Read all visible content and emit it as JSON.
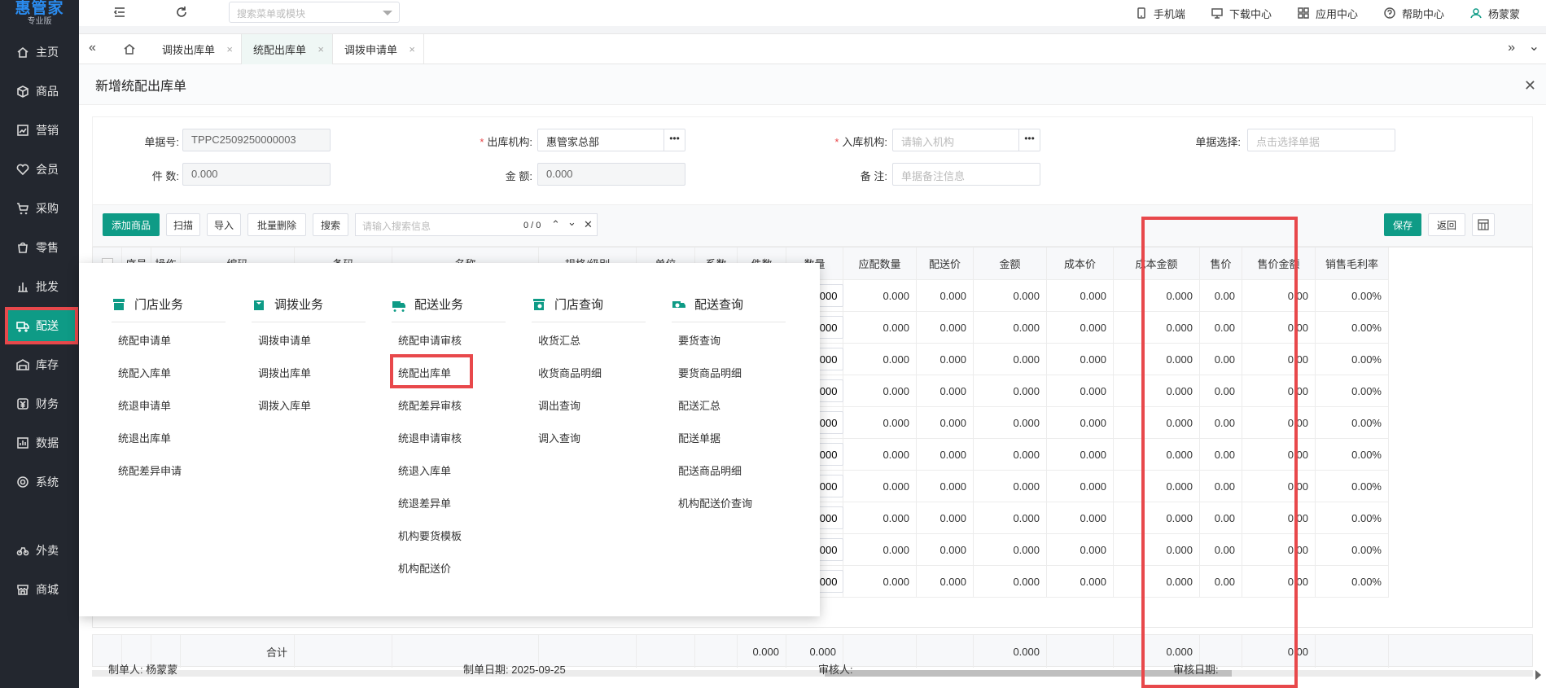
{
  "brand": {
    "name": "惠管家",
    "edition": "专业版"
  },
  "sidebar": {
    "items": [
      {
        "label": "主页",
        "icon": "home-icon"
      },
      {
        "label": "商品",
        "icon": "box-icon"
      },
      {
        "label": "营销",
        "icon": "chart-icon"
      },
      {
        "label": "会员",
        "icon": "heart-icon"
      },
      {
        "label": "采购",
        "icon": "cart-icon"
      },
      {
        "label": "零售",
        "icon": "bag-icon"
      },
      {
        "label": "批发",
        "icon": "bars-icon"
      },
      {
        "label": "配送",
        "icon": "truck-icon",
        "active": true
      },
      {
        "label": "库存",
        "icon": "warehouse-icon"
      },
      {
        "label": "财务",
        "icon": "money-icon"
      },
      {
        "label": "数据",
        "icon": "data-icon"
      },
      {
        "label": "系统",
        "icon": "gear-icon"
      },
      {
        "label": "外卖",
        "icon": "bike-icon"
      },
      {
        "label": "商城",
        "icon": "store-icon"
      }
    ]
  },
  "header": {
    "search_placeholder": "搜索菜单或模块",
    "links": [
      "手机端",
      "下载中心",
      "应用中心",
      "帮助中心"
    ],
    "user": "杨蒙蒙"
  },
  "tabs": [
    "调拨出库单",
    "统配出库单",
    "调拨申请单"
  ],
  "page": {
    "title": "新增统配出库单",
    "form": {
      "doc_no_label": "单据号:",
      "doc_no": "TPPC2509250000003",
      "out_org_label": "出库机构:",
      "out_org": "惠管家总部",
      "in_org_label": "入库机构:",
      "in_org_placeholder": "请输入机构",
      "doc_select_label": "单据选择:",
      "doc_select_placeholder": "点击选择单据",
      "pieces_label": "件  数:",
      "pieces": "0.000",
      "amount_label": "金  额:",
      "amount": "0.000",
      "remark_label": "备  注:",
      "remark_placeholder": "单据备注信息"
    },
    "toolbar": {
      "add": "添加商品",
      "scan": "扫描",
      "import": "导入",
      "batch_delete": "批量删除",
      "search": "搜索",
      "search_placeholder": "请输入搜索信息",
      "counter": "0 / 0",
      "save": "保存",
      "back": "返回"
    },
    "table": {
      "headers": [
        "序号",
        "操作",
        "编码",
        "条码",
        "名称",
        "规格/级别",
        "单位",
        "系数",
        "件数",
        "数量",
        "应配数量",
        "配送价",
        "金额",
        "成本价",
        "成本金额",
        "售价",
        "售价金额",
        "销售毛利率"
      ],
      "row_values": {
        "pieces": "0.000",
        "qty": "0.000",
        "plan_qty": "0.000",
        "price": "0.000",
        "amount": "0.000",
        "cost": "0.000",
        "cost_amount": "0.000",
        "sale": "0.00",
        "sale_amount": "0.00",
        "margin": "0.00%"
      },
      "row_count": 10,
      "total_label": "合计",
      "totals": {
        "pieces": "0.000",
        "qty": "0.000",
        "amount": "0.000",
        "cost_amount": "0.000",
        "sale_amount": "0.00"
      }
    },
    "footer": {
      "creator_label": "制单人:",
      "creator": "杨蒙蒙",
      "date_label": "制单日期:",
      "date": "2025-09-25",
      "auditor_label": "审核人:",
      "audit_date_label": "审核日期:"
    }
  },
  "mega_menu": {
    "columns": [
      {
        "title": "门店业务",
        "items": [
          "统配申请单",
          "统配入库单",
          "统退申请单",
          "统退出库单",
          "统配差异申请"
        ]
      },
      {
        "title": "调拨业务",
        "items": [
          "调拨申请单",
          "调拨出库单",
          "调拨入库单"
        ]
      },
      {
        "title": "配送业务",
        "items": [
          "统配申请审核",
          "统配出库单",
          "统配差异审核",
          "统退申请审核",
          "统退入库单",
          "统退差异单",
          "机构要货模板",
          "机构配送价"
        ]
      },
      {
        "title": "门店查询",
        "items": [
          "收货汇总",
          "收货商品明细",
          "调出查询",
          "调入查询"
        ]
      },
      {
        "title": "配送查询",
        "items": [
          "要货查询",
          "要货商品明细",
          "配送汇总",
          "配送单据",
          "配送商品明细",
          "机构配送价查询"
        ]
      }
    ]
  },
  "colors": {
    "accent": "#0e9b86",
    "highlight": "#e8484b",
    "sidebar": "#23272f"
  }
}
